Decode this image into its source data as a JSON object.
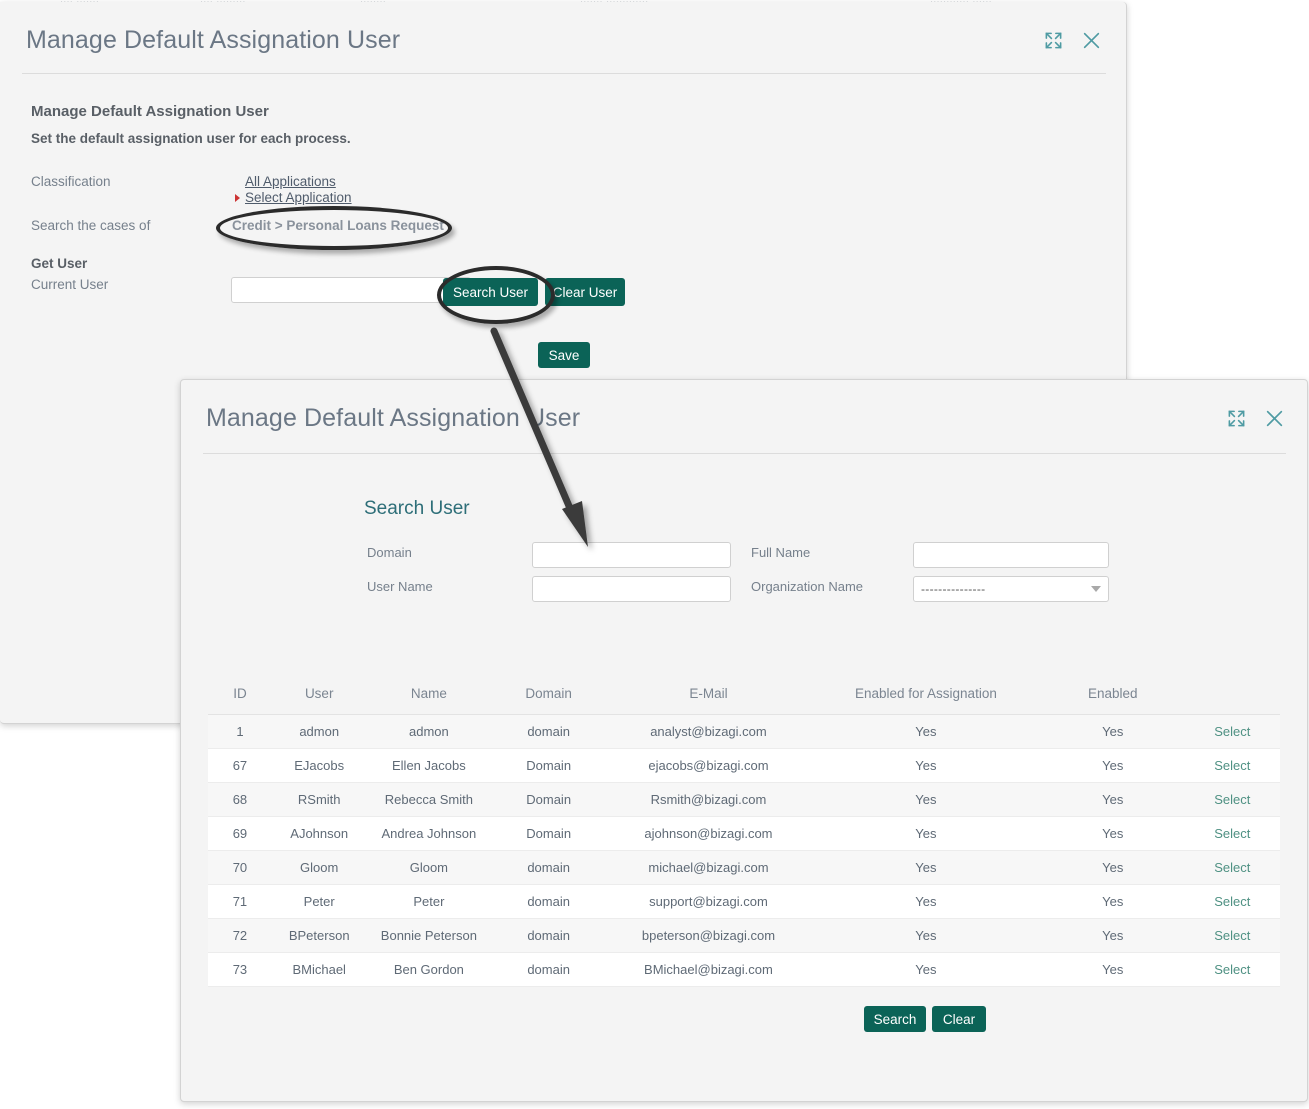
{
  "background_sliver": {
    "fragments": [
      "....  .......",
      "....  .........",
      "........",
      ".......  .............",
      "............  ......"
    ]
  },
  "modal1": {
    "title": "Manage Default Assignation User",
    "header_icons": [
      {
        "name": "expand-icon",
        "label": "Expand"
      },
      {
        "name": "close-icon",
        "label": "Close"
      }
    ],
    "section_heading": "Manage Default Assignation User",
    "section_subheading": "Set the default assignation user for each process.",
    "fields": {
      "classification_label": "Classification",
      "all_applications_link": "All Applications",
      "select_application_link": "Select Application",
      "search_cases_label": "Search the cases of",
      "breadcrumb_value": "Credit > Personal Loans Request",
      "get_user_label": "Get User",
      "current_user_label": "Current User",
      "current_user_value": "",
      "current_user_placeholder": ""
    },
    "buttons": {
      "search_user": "Search User",
      "clear_user": "Clear User",
      "save": "Save"
    }
  },
  "modal2": {
    "title": "Manage Default Assignation User",
    "header_icons": [
      {
        "name": "expand-icon",
        "label": "Expand"
      },
      {
        "name": "close-icon",
        "label": "Close"
      }
    ],
    "search_heading": "Search User",
    "form": {
      "domain_label": "Domain",
      "domain_value": "",
      "user_name_label": "User Name",
      "user_name_value": "",
      "full_name_label": "Full Name",
      "full_name_value": "",
      "organization_name_label": "Organization Name",
      "organization_name_value": "---------------"
    },
    "buttons": {
      "search": "Search",
      "clear": "Clear"
    },
    "table": {
      "columns": [
        "ID",
        "User",
        "Name",
        "Domain",
        "E-Mail",
        "Enabled for Assignation",
        "Enabled",
        ""
      ],
      "select_label": "Select",
      "rows": [
        {
          "id": "1",
          "user": "admon",
          "name": "admon",
          "domain": "domain",
          "email": "analyst@bizagi.com",
          "enabled_for_assignation": "Yes",
          "enabled": "Yes"
        },
        {
          "id": "67",
          "user": "EJacobs",
          "name": "Ellen Jacobs",
          "domain": "Domain",
          "email": "ejacobs@bizagi.com",
          "enabled_for_assignation": "Yes",
          "enabled": "Yes"
        },
        {
          "id": "68",
          "user": "RSmith",
          "name": "Rebecca Smith",
          "domain": "Domain",
          "email": "Rsmith@bizagi.com",
          "enabled_for_assignation": "Yes",
          "enabled": "Yes"
        },
        {
          "id": "69",
          "user": "AJohnson",
          "name": "Andrea Johnson",
          "domain": "Domain",
          "email": "ajohnson@bizagi.com",
          "enabled_for_assignation": "Yes",
          "enabled": "Yes"
        },
        {
          "id": "70",
          "user": "Gloom",
          "name": "Gloom",
          "domain": "domain",
          "email": "michael@bizagi.com",
          "enabled_for_assignation": "Yes",
          "enabled": "Yes"
        },
        {
          "id": "71",
          "user": "Peter",
          "name": "Peter",
          "domain": "domain",
          "email": "support@bizagi.com",
          "enabled_for_assignation": "Yes",
          "enabled": "Yes"
        },
        {
          "id": "72",
          "user": "BPeterson",
          "name": "Bonnie Peterson",
          "domain": "domain",
          "email": "bpeterson@bizagi.com",
          "enabled_for_assignation": "Yes",
          "enabled": "Yes"
        },
        {
          "id": "73",
          "user": "BMichael",
          "name": "Ben Gordon",
          "domain": "domain",
          "email": "BMichael@bizagi.com",
          "enabled_for_assignation": "Yes",
          "enabled": "Yes"
        }
      ]
    }
  },
  "annotations": {
    "ellipse_breadcrumb_target": "Credit > Personal Loans Request",
    "ellipse_button_target": "Search User",
    "arrow_from": "Search User",
    "arrow_to": "Domain"
  },
  "colors": {
    "button_green": "#0b6357",
    "icon_teal": "#4f9ba3",
    "link_select": "#4f9183",
    "heading_gray": "#6b7785",
    "modal_background": "#f4f4f4",
    "annotation_black": "#2b2b2b",
    "bullet_red": "#cc3333"
  }
}
